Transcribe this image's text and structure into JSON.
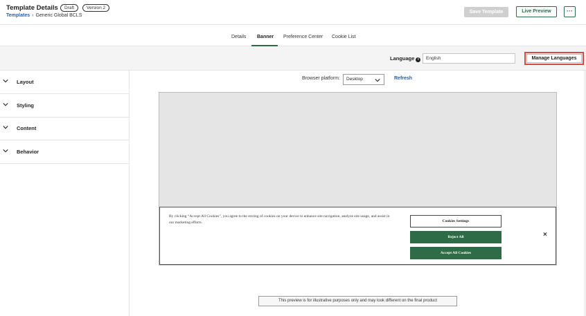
{
  "header": {
    "title": "Template Details",
    "badges": {
      "draft": "Draft",
      "version": "Version 2"
    },
    "breadcrumb": {
      "root": "Templates",
      "separator": "›",
      "current": "Generic Global BCLS"
    },
    "save_label": "Save Template",
    "live_preview_label": "Live Preview",
    "more_label": "···"
  },
  "tabs": [
    {
      "label": "Details"
    },
    {
      "label": "Banner",
      "active": true
    },
    {
      "label": "Preference Center"
    },
    {
      "label": "Cookie List"
    }
  ],
  "language_bar": {
    "label": "Language",
    "info_icon": "info-icon",
    "value": "English",
    "manage_label": "Manage Languages"
  },
  "sidebar": {
    "items": [
      {
        "label": "Layout",
        "icon": "chevron-down-icon"
      },
      {
        "label": "Styling",
        "icon": "chevron-down-icon"
      },
      {
        "label": "Content",
        "icon": "chevron-down-icon"
      },
      {
        "label": "Behavior",
        "icon": "chevron-down-icon"
      }
    ]
  },
  "preview": {
    "platform_label": "Browser platform:",
    "platform_value": "Desktop",
    "refresh_label": "Refresh",
    "banner": {
      "text": "By clicking “Accept All Cookies”, you agree to the storing of cookies on your device to enhance site navigation, analyze site usage, and assist in our marketing efforts.",
      "settings_label": "Cookies Settings",
      "reject_label": "Reject All",
      "accept_label": "Accept All Cookies",
      "close_label": "×"
    },
    "disclaimer": "This preview is for illustrative purposes only and may look different on the final product"
  },
  "colors": {
    "accent_green": "#2e6b47",
    "link_blue": "#1f5fa8",
    "highlight_red": "#d64a44"
  }
}
